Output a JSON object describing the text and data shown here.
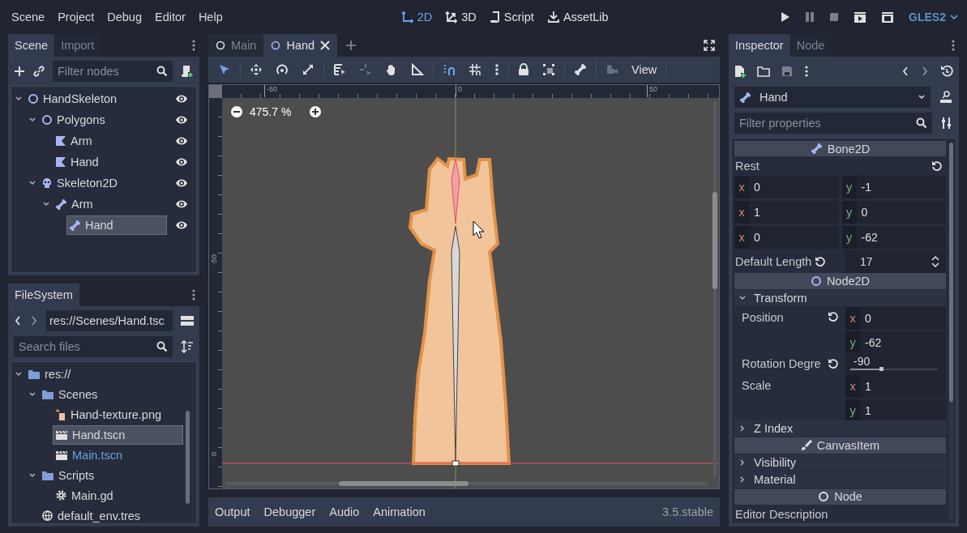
{
  "menu": [
    "Scene",
    "Project",
    "Debug",
    "Editor",
    "Help"
  ],
  "workspaces": [
    {
      "kind": "plane",
      "label": "2D",
      "selected": true
    },
    {
      "kind": "space",
      "label": "3D",
      "selected": false
    },
    {
      "kind": "script",
      "label": "Script",
      "selected": false
    },
    {
      "kind": "assetlib",
      "label": "AssetLib",
      "selected": false
    }
  ],
  "renderer": "GLES2",
  "scene_dock": {
    "tabs": [
      {
        "label": "Scene",
        "selected": true
      },
      {
        "label": "Import",
        "selected": false
      }
    ],
    "filter_placeholder": "Filter nodes",
    "tree": [
      {
        "kind": "node2d",
        "name": "HandSkeleton",
        "visible": true,
        "selected": false,
        "expanded": true,
        "children": [
          {
            "kind": "node2d",
            "name": "Polygons",
            "visible": true,
            "selected": false,
            "expanded": true,
            "children": [
              {
                "kind": "polygon",
                "name": "Arm",
                "visible": true,
                "selected": false
              },
              {
                "kind": "polygon",
                "name": "Hand",
                "visible": true,
                "selected": false
              }
            ]
          },
          {
            "kind": "skeleton",
            "name": "Skeleton2D",
            "visible": true,
            "selected": false,
            "expanded": true,
            "children": [
              {
                "kind": "bone",
                "name": "Arm",
                "visible": true,
                "selected": false,
                "expanded": true,
                "children": [
                  {
                    "kind": "bone",
                    "name": "Hand",
                    "visible": true,
                    "selected": true
                  }
                ]
              }
            ]
          }
        ]
      }
    ]
  },
  "filesystem": {
    "tabs": [
      {
        "label": "FileSystem",
        "selected": true
      }
    ],
    "path": "res://Scenes/Hand.tsc",
    "search_placeholder": "Search files",
    "tree": [
      {
        "kind": "folder",
        "name": "res://",
        "selected": false,
        "main_scene": false,
        "expanded": true,
        "children": [
          {
            "kind": "folder",
            "name": "Scenes",
            "selected": false,
            "main_scene": false,
            "expanded": true,
            "children": [
              {
                "kind": "image",
                "name": "Hand-texture.png",
                "selected": false,
                "main_scene": false
              },
              {
                "kind": "scene",
                "name": "Hand.tscn",
                "selected": true,
                "main_scene": false
              },
              {
                "kind": "scene",
                "name": "Main.tscn",
                "selected": false,
                "main_scene": true
              }
            ]
          },
          {
            "kind": "folder",
            "name": "Scripts",
            "selected": false,
            "main_scene": false,
            "expanded": true,
            "children": [
              {
                "kind": "script",
                "name": "Main.gd",
                "selected": false,
                "main_scene": false
              }
            ]
          },
          {
            "kind": "environment",
            "name": "default_env.tres",
            "selected": false,
            "main_scene": false
          }
        ]
      }
    ]
  },
  "editor_tabs": [
    {
      "label": "Main",
      "selected": false
    },
    {
      "label": "Hand",
      "selected": true
    }
  ],
  "tools": [
    {
      "kind": "select",
      "selected": true,
      "disabled": false
    },
    {
      "kind": "move",
      "selected": false,
      "disabled": false
    },
    {
      "kind": "rotate",
      "selected": false,
      "disabled": false
    },
    {
      "kind": "scale",
      "selected": false,
      "disabled": false
    },
    {
      "kind": "list",
      "selected": false,
      "disabled": false
    },
    {
      "kind": "pivot",
      "selected": false,
      "disabled": true
    },
    {
      "kind": "pan",
      "selected": false,
      "disabled": false
    },
    {
      "kind": "ruler",
      "selected": false,
      "disabled": false
    },
    {
      "kind": "smartsnap",
      "selected": true,
      "disabled": false
    },
    {
      "kind": "gridsnap",
      "selected": false,
      "disabled": false
    },
    {
      "kind": "more",
      "selected": false,
      "disabled": false
    },
    {
      "kind": "lock",
      "selected": false,
      "disabled": false
    },
    {
      "kind": "group",
      "selected": false,
      "disabled": false
    },
    {
      "kind": "bone",
      "selected": false,
      "disabled": false
    },
    {
      "kind": "camera",
      "selected": false,
      "disabled": true
    }
  ],
  "view_menu": "View",
  "viewport": {
    "zoom": "475.7 %",
    "top_ruler": [
      "-50",
      "0",
      "50"
    ],
    "left_ruler": [
      "-50",
      "0"
    ]
  },
  "bottom_panel": {
    "tabs": [
      "Output",
      "Debugger",
      "Audio",
      "Animation"
    ],
    "version": "3.5.stable"
  },
  "inspector": {
    "tabs": [
      {
        "label": "Inspector",
        "selected": true
      },
      {
        "label": "Node",
        "selected": false
      }
    ],
    "node": "Hand",
    "filter_placeholder": "Filter properties",
    "items": [
      {
        "kind": "category",
        "label": "Bone2D"
      },
      {
        "kind": "label",
        "label": "Rest",
        "revert": true
      },
      {
        "kind": "pair",
        "cells": [
          {
            "axis": "x",
            "value": "0"
          },
          {
            "axis": "y",
            "value": "-1"
          }
        ]
      },
      {
        "kind": "pair",
        "cells": [
          {
            "axis": "x",
            "value": "1"
          },
          {
            "axis": "y",
            "value": "0"
          }
        ]
      },
      {
        "kind": "pair",
        "cells": [
          {
            "axis": "x",
            "value": "0"
          },
          {
            "axis": "y",
            "value": "-62"
          }
        ]
      },
      {
        "kind": "spin",
        "label": "Default Length",
        "revert": true,
        "value": "17"
      },
      {
        "kind": "category",
        "label": "Node2D"
      },
      {
        "kind": "group",
        "label": "Transform",
        "expanded": true
      },
      {
        "kind": "vector",
        "label": "Position",
        "revert": true,
        "cells": [
          {
            "axis": "x",
            "value": "0"
          },
          {
            "axis": "y",
            "value": "-62"
          }
        ]
      },
      {
        "kind": "slider",
        "label": "Rotation Degre",
        "revert": true,
        "value": "-90",
        "level": 0.35
      },
      {
        "kind": "vector",
        "label": "Scale",
        "revert": false,
        "cells": [
          {
            "axis": "x",
            "value": "1"
          },
          {
            "axis": "y",
            "value": "1"
          }
        ]
      },
      {
        "kind": "group",
        "label": "Z Index",
        "expanded": false
      },
      {
        "kind": "category",
        "label": "CanvasItem"
      },
      {
        "kind": "group",
        "label": "Visibility",
        "expanded": false
      },
      {
        "kind": "group",
        "label": "Material",
        "expanded": false
      },
      {
        "kind": "category",
        "label": "Node"
      },
      {
        "kind": "label",
        "label": "Editor Description",
        "revert": false
      }
    ]
  }
}
